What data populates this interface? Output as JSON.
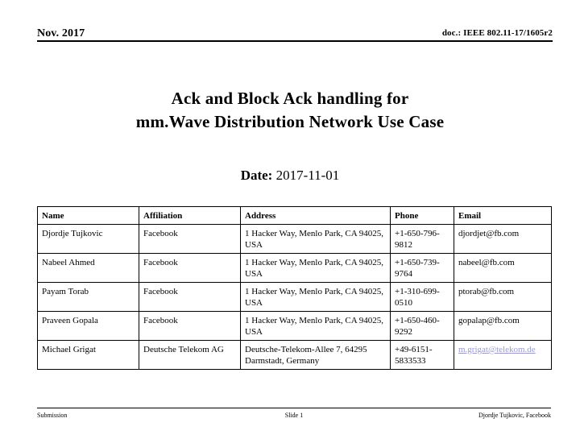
{
  "header": {
    "date": "Nov. 2017",
    "doc_id": "doc.: IEEE 802.11-17/1605r2"
  },
  "title": {
    "line1": "Ack and Block Ack handling for",
    "line2": "mm.Wave Distribution Network Use Case"
  },
  "date_line": {
    "label": "Date:",
    "value": "2017-11-01"
  },
  "authors_table": {
    "columns": [
      "Name",
      "Affiliation",
      "Address",
      "Phone",
      "Email"
    ],
    "rows": [
      {
        "name": "Djordje Tujkovic",
        "affiliation": "Facebook",
        "address": "1 Hacker Way, Menlo Park, CA 94025, USA",
        "phone": "+1-650-796-9812",
        "email": "djordjet@fb.com",
        "email_is_link": false
      },
      {
        "name": "Nabeel Ahmed",
        "affiliation": "Facebook",
        "address": "1 Hacker Way, Menlo Park, CA 94025, USA",
        "phone": "+1-650-739-9764",
        "email": "nabeel@fb.com",
        "email_is_link": false
      },
      {
        "name": "Payam Torab",
        "affiliation": "Facebook",
        "address": "1 Hacker Way, Menlo Park, CA 94025, USA",
        "phone": "+1-310-699-0510",
        "email": "ptorab@fb.com",
        "email_is_link": false
      },
      {
        "name": "Praveen Gopala",
        "affiliation": "Facebook",
        "address": "1 Hacker Way, Menlo Park, CA 94025, USA",
        "phone": "+1-650-460-9292",
        "email": "gopalap@fb.com",
        "email_is_link": false
      },
      {
        "name": "Michael Grigat",
        "affiliation": "Deutsche Telekom AG",
        "address": "Deutsche-Telekom-Allee 7, 64295 Darmstadt, Germany",
        "phone": "+49-6151-5833533",
        "email": "m.grigat@telekom.de",
        "email_is_link": true
      }
    ]
  },
  "footer": {
    "left": "Submission",
    "center": "Slide 1",
    "right": "Djordje Tujkovic, Facebook"
  },
  "colors": {
    "link": "#9a9acd",
    "text": "#000000",
    "background": "#ffffff"
  }
}
